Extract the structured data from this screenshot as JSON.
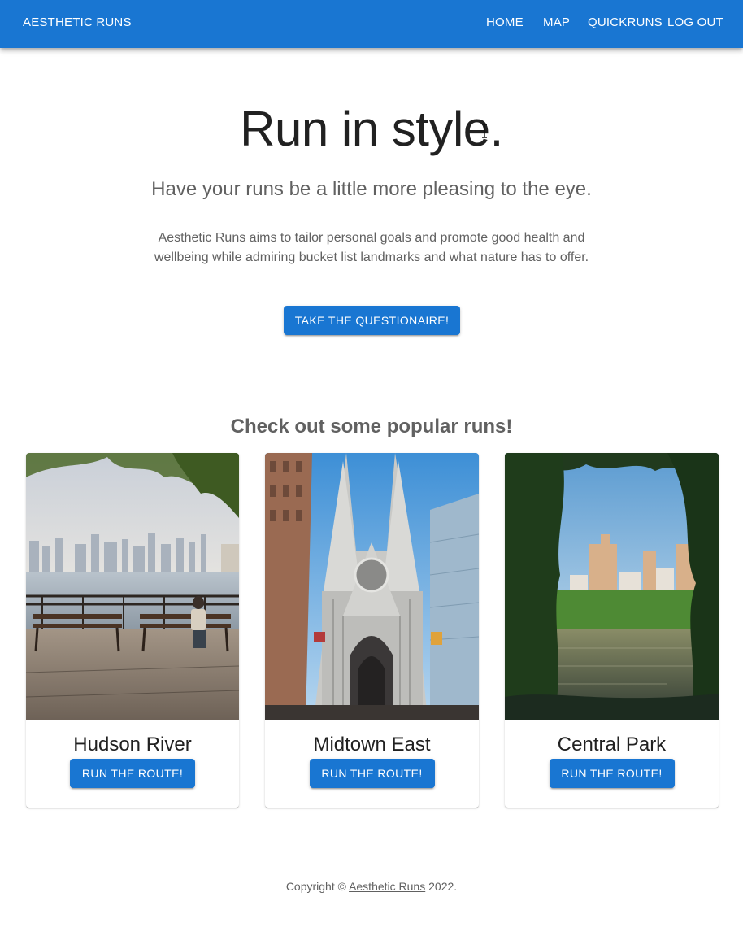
{
  "header": {
    "brand": "AESTHETIC RUNS",
    "nav": {
      "home": "HOME",
      "map": "MAP",
      "quickruns": "QUICKRUNS",
      "logout": "LOG OUT"
    }
  },
  "hero": {
    "title": "Run in style.",
    "subtitle": "Have your runs be a little more pleasing to the eye.",
    "description": "Aesthetic Runs aims to tailor personal goals and promote good health and wellbeing while admiring bucket list landmarks and what nature has to offer.",
    "cta": "TAKE THE QUESTIONAIRE!"
  },
  "popular": {
    "heading": "Check out some popular runs!",
    "cards": [
      {
        "title": "Hudson River",
        "button": "RUN THE ROUTE!"
      },
      {
        "title": "Midtown East",
        "button": "RUN THE ROUTE!"
      },
      {
        "title": "Central Park",
        "button": "RUN THE ROUTE!"
      }
    ]
  },
  "footer": {
    "prefix": "Copyright © ",
    "link": "Aesthetic Runs",
    "suffix": " 2022."
  },
  "colors": {
    "primary": "#1976d2",
    "text": "#212121",
    "muted": "#616161"
  }
}
